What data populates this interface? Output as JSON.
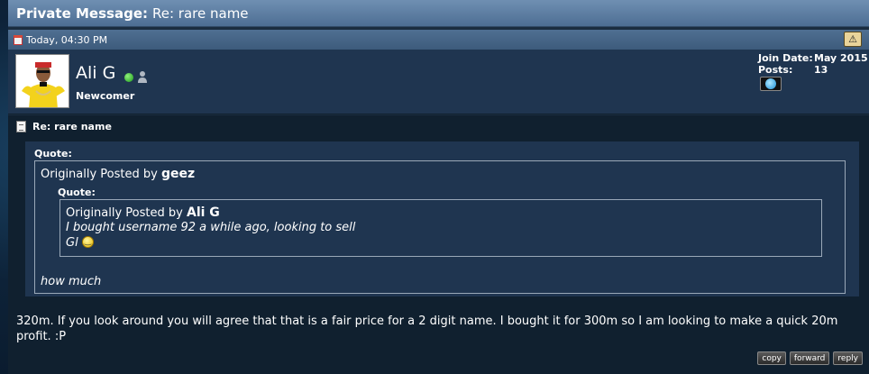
{
  "header": {
    "title_strong": "Private Message:",
    "title_rest": "Re: rare name"
  },
  "post": {
    "date": "Today, 04:30 PM",
    "warn_icon": "warning-icon",
    "user": {
      "name": "Ali G",
      "rank": "Newcomer",
      "status": "online",
      "join_date_label": "Join Date:",
      "join_date_value": "May 2015",
      "posts_label": "Posts:",
      "posts_value": "13"
    },
    "title": "Re: rare name",
    "quote_outer": {
      "label": "Quote:",
      "prefix": "Originally Posted by",
      "author": "geez",
      "text": "how much"
    },
    "quote_inner": {
      "label": "Quote:",
      "prefix": "Originally Posted by",
      "author": "Ali G",
      "line1": "I bought username 92 a while ago, looking to sell",
      "line2": "Gl"
    },
    "body": "320m. If you look around you will agree that that is a fair price for a 2 digit name. I bought it for 300m so I am looking to make a quick 20m profit. :P",
    "actions": {
      "copy": "copy",
      "forward": "forward",
      "reply": "reply"
    }
  },
  "colors": {
    "panel": "#1b2d40",
    "title_bar": "#5b7ca1",
    "quote_bg": "#1f3550"
  }
}
